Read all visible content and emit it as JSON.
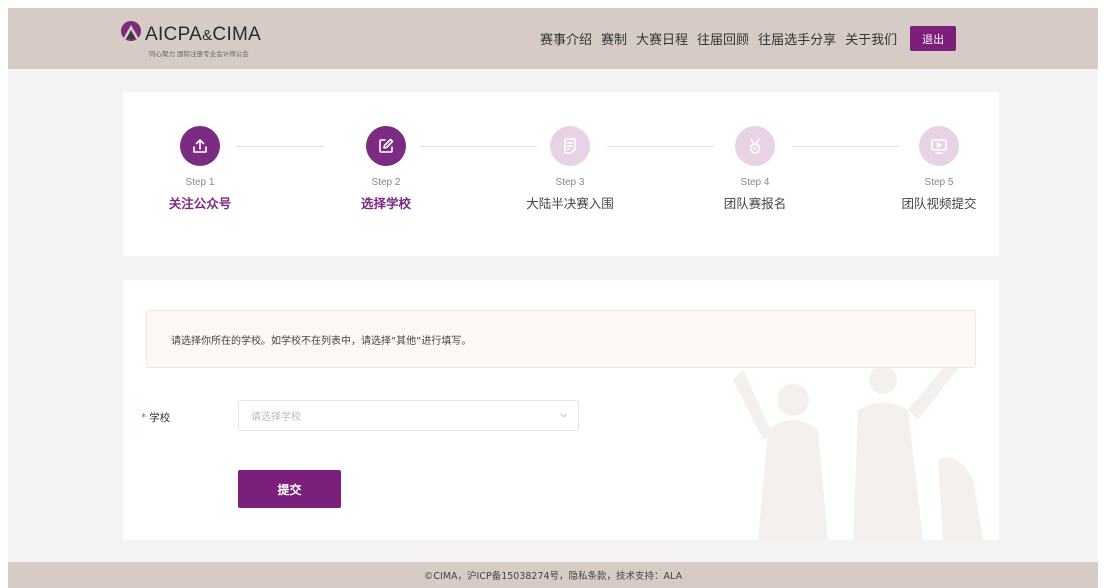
{
  "brand": {
    "name": "AICPA&CIMA",
    "name_main": "AICPA",
    "name_amp": "&",
    "name_end": "CIMA",
    "tagline": "同心聚力 国际注册专业会计师公会"
  },
  "nav": {
    "items": [
      "赛事介绍",
      "赛制",
      "大赛日程",
      "往届回顾",
      "往届选手分享",
      "关于我们"
    ],
    "logout_label": "退出"
  },
  "steps": [
    {
      "small": "Step 1",
      "label": "关注公众号",
      "state": "active",
      "icon": "upload-icon"
    },
    {
      "small": "Step 2",
      "label": "选择学校",
      "state": "active",
      "icon": "edit-icon"
    },
    {
      "small": "Step 3",
      "label": "大陆半决赛入围",
      "state": "inactive",
      "icon": "document-icon"
    },
    {
      "small": "Step 4",
      "label": "团队赛报名",
      "state": "inactive",
      "icon": "medal-icon"
    },
    {
      "small": "Step 5",
      "label": "团队视频提交",
      "state": "inactive",
      "icon": "video-icon"
    }
  ],
  "form": {
    "notice": "请选择你所在的学校。如学校不在列表中，请选择“其他”进行填写。",
    "school_label": "学校",
    "required_mark": "*",
    "school_placeholder": "请选择学校",
    "submit_label": "提交"
  },
  "footer": {
    "text": "©CIMA，沪ICP备15038274号，隐私条款，技术支持：ALA"
  },
  "colors": {
    "accent": "#7b1f7b",
    "header_bg": "#d6ccc5",
    "step_inactive": "#e7d2e6"
  }
}
